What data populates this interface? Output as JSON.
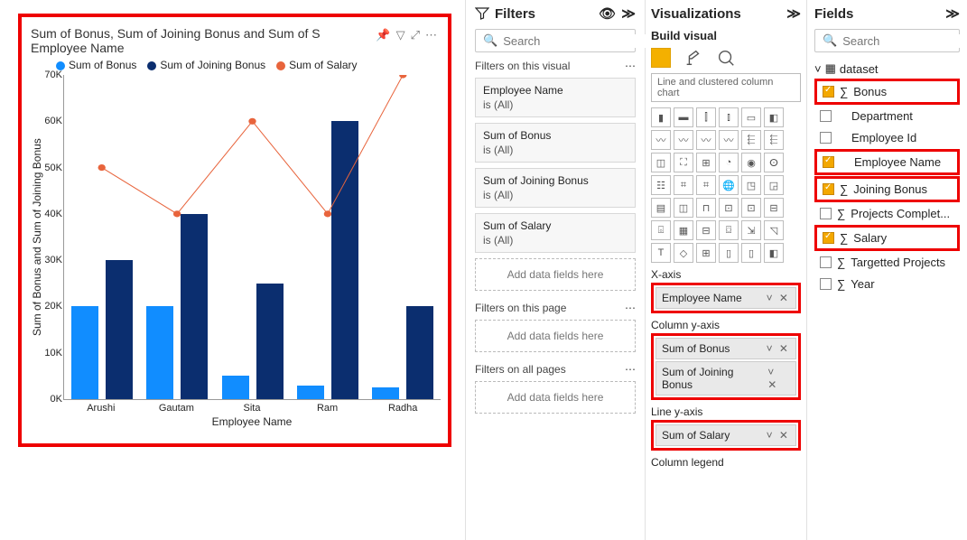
{
  "panels": {
    "filters": "Filters",
    "viz": "Visualizations",
    "build": "Build visual",
    "fields": "Fields"
  },
  "search": {
    "placeholder": "Search"
  },
  "chart": {
    "title": "Sum of Bonus, Sum of Joining Bonus and Sum of S",
    "subtitle": "Employee Name",
    "legend": [
      "Sum of Bonus",
      "Sum of Joining Bonus",
      "Sum of Salary"
    ],
    "colors": {
      "bonus": "#118dff",
      "joining": "#0b2e6f",
      "salary": "#e8643c"
    },
    "ylabel": "Sum of Bonus and Sum of Joining Bonus",
    "xlabel": "Employee Name",
    "yticks": [
      "0K",
      "10K",
      "20K",
      "30K",
      "40K",
      "50K",
      "60K",
      "70K"
    ]
  },
  "chart_data": {
    "type": "bar",
    "categories": [
      "Arushi",
      "Gautam",
      "Sita",
      "Ram",
      "Radha"
    ],
    "series": [
      {
        "name": "Sum of Bonus",
        "values": [
          20000,
          20000,
          5000,
          3000,
          2500
        ]
      },
      {
        "name": "Sum of Joining Bonus",
        "values": [
          30000,
          40000,
          25000,
          60000,
          20000
        ]
      },
      {
        "name": "Sum of Salary",
        "values": [
          50000,
          40000,
          60000,
          40000,
          70000
        ],
        "style": "line"
      }
    ],
    "title": "Sum of Bonus, Sum of Joining Bonus and Sum of Salary by Employee Name",
    "xlabel": "Employee Name",
    "ylabel": "Sum of Bonus and Sum of Joining Bonus",
    "ylim": [
      0,
      70000
    ]
  },
  "filters": {
    "onVisual": "Filters on this visual",
    "onPage": "Filters on this page",
    "onAll": "Filters on all pages",
    "addFields": "Add data fields here",
    "cards": [
      {
        "name": "Employee Name",
        "val": "is (All)"
      },
      {
        "name": "Sum of Bonus",
        "val": "is (All)"
      },
      {
        "name": "Sum of Joining Bonus",
        "val": "is (All)"
      },
      {
        "name": "Sum of Salary",
        "val": "is (All)"
      }
    ]
  },
  "viz": {
    "tooltip": "Line and clustered column chart",
    "wells": {
      "xaxis": {
        "label": "X-axis",
        "items": [
          "Employee Name"
        ]
      },
      "coly": {
        "label": "Column y-axis",
        "items": [
          "Sum of Bonus",
          "Sum of Joining Bonus"
        ]
      },
      "liney": {
        "label": "Line y-axis",
        "items": [
          "Sum of Salary"
        ]
      },
      "legend": {
        "label": "Column legend"
      }
    }
  },
  "fields": {
    "root": "dataset",
    "items": [
      {
        "name": "Bonus",
        "sigma": true,
        "checked": true,
        "boxed": true
      },
      {
        "name": "Department",
        "sigma": false,
        "checked": false,
        "boxed": false
      },
      {
        "name": "Employee Id",
        "sigma": false,
        "checked": false,
        "boxed": false
      },
      {
        "name": "Employee Name",
        "sigma": false,
        "checked": true,
        "boxed": true
      },
      {
        "name": "Joining Bonus",
        "sigma": true,
        "checked": true,
        "boxed": true
      },
      {
        "name": "Projects Complet...",
        "sigma": true,
        "checked": false,
        "boxed": false
      },
      {
        "name": "Salary",
        "sigma": true,
        "checked": true,
        "boxed": true
      },
      {
        "name": "Targetted Projects",
        "sigma": true,
        "checked": false,
        "boxed": false
      },
      {
        "name": "Year",
        "sigma": true,
        "checked": false,
        "boxed": false
      }
    ]
  }
}
